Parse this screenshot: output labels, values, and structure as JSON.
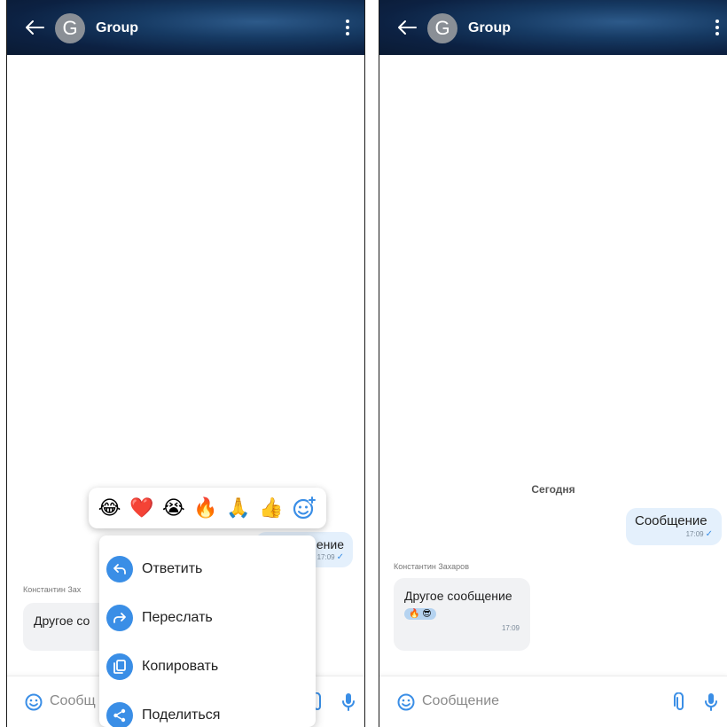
{
  "left_screen": {
    "header": {
      "avatar_letter": "G",
      "title": "Group"
    },
    "outgoing": {
      "text_partial": "ение",
      "time": "17:09"
    },
    "incoming": {
      "sender_partial": "Константин Зах",
      "text_partial": "Другое со"
    },
    "input": {
      "placeholder_partial": "Сообщ"
    },
    "reactions": [
      "😂",
      "❤️",
      "😭",
      "🔥",
      "🙏",
      "👍"
    ],
    "context_menu": [
      {
        "label": "Ответить",
        "icon": "reply-icon"
      },
      {
        "label": "Переслать",
        "icon": "forward-icon"
      },
      {
        "label": "Копировать",
        "icon": "copy-icon"
      },
      {
        "label": "Поделиться",
        "icon": "share-icon"
      }
    ]
  },
  "right_screen": {
    "header": {
      "avatar_letter": "G",
      "title": "Group"
    },
    "date_separator": "Сегодня",
    "outgoing": {
      "text": "Сообщение",
      "time": "17:09"
    },
    "incoming": {
      "sender": "Константин Захаров",
      "text": "Другое сообщение",
      "reactions": "🔥 😎",
      "time": "17:09"
    },
    "input": {
      "placeholder": "Сообщение"
    }
  },
  "colors": {
    "header_dark": "#0c2142",
    "accent": "#3a8ee6",
    "outgoing_bubble": "#e4f0fc",
    "incoming_bubble": "#f1f2f4"
  }
}
